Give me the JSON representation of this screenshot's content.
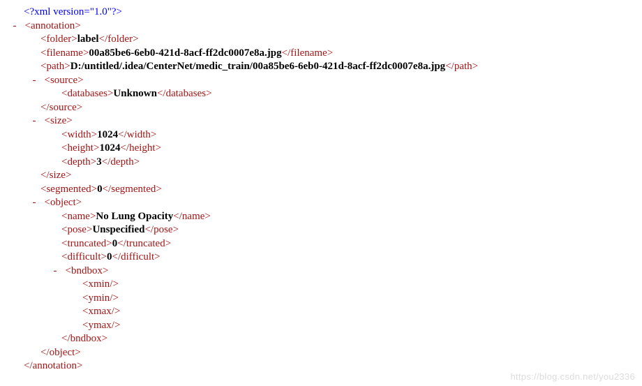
{
  "toggle": "-",
  "xml_decl": "<?xml version=\"1.0\"?>",
  "root_open": "annotation",
  "root_close": "annotation",
  "folder": {
    "open": "folder",
    "val": "label",
    "close": "folder"
  },
  "filename": {
    "open": "filename",
    "val": "00a85be6-6eb0-421d-8acf-ff2dc0007e8a.jpg",
    "close": "filename"
  },
  "path": {
    "open": "path",
    "val": "D:/untitled/.idea/CenterNet/medic_train/00a85be6-6eb0-421d-8acf-ff2dc0007e8a.jpg",
    "close": "path"
  },
  "source": {
    "open": "source",
    "close": "source",
    "databases": {
      "open": "databases",
      "val": "Unknown",
      "close": "databases"
    }
  },
  "size": {
    "open": "size",
    "close": "size",
    "width": {
      "open": "width",
      "val": "1024",
      "close": "width"
    },
    "height": {
      "open": "height",
      "val": "1024",
      "close": "height"
    },
    "depth": {
      "open": "depth",
      "val": "3",
      "close": "depth"
    }
  },
  "segmented": {
    "open": "segmented",
    "val": "0",
    "close": "segmented"
  },
  "object": {
    "open": "object",
    "close": "object",
    "name": {
      "open": "name",
      "val": "No Lung Opacity",
      "close": "name"
    },
    "pose": {
      "open": "pose",
      "val": "Unspecified",
      "close": "pose"
    },
    "truncated": {
      "open": "truncated",
      "val": "0",
      "close": "truncated"
    },
    "difficult": {
      "open": "difficult",
      "val": "0",
      "close": "difficult"
    },
    "bndbox": {
      "open": "bndbox",
      "close": "bndbox",
      "xmin": "xmin",
      "ymin": "ymin",
      "xmax": "xmax",
      "ymax": "ymax"
    }
  },
  "watermark": "https://blog.csdn.net/you2336"
}
